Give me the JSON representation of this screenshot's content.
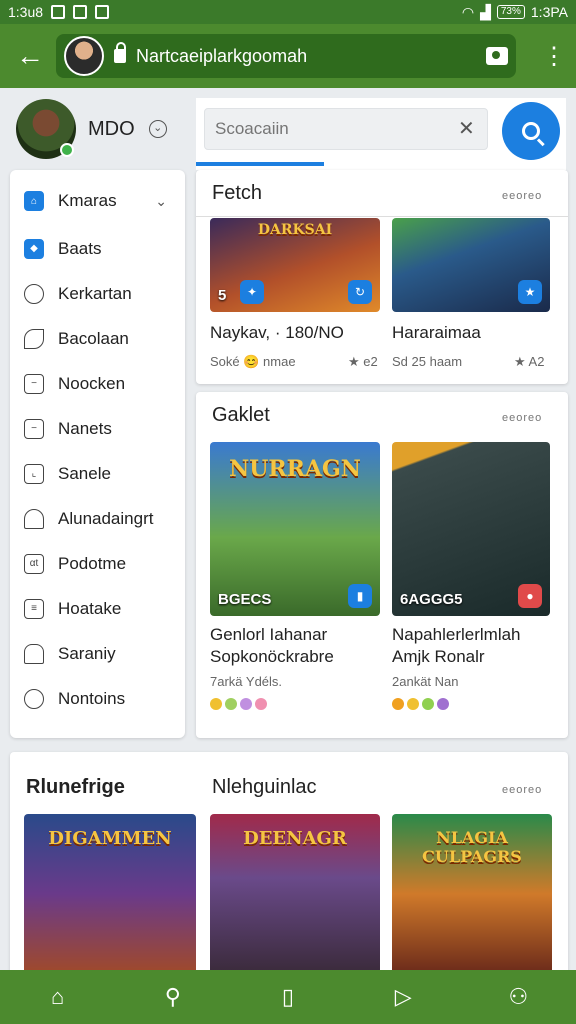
{
  "status_bar": {
    "time_left": "1:3u8",
    "time_right": "1:3PA",
    "battery": "73%"
  },
  "browser": {
    "url": "Nartcaeiplarkgoomah"
  },
  "profile": {
    "name": "MDO"
  },
  "sidebar": {
    "items": [
      {
        "label": "Kmaras",
        "icon": "home-icon",
        "active": true,
        "has_chevron": true
      },
      {
        "label": "Baats",
        "icon": "diamond-icon",
        "active": true
      },
      {
        "label": "Kerkartan",
        "icon": "chat-icon"
      },
      {
        "label": "Bacolaan",
        "icon": "leaf-icon"
      },
      {
        "label": "Noocken",
        "icon": "square-icon"
      },
      {
        "label": "Nanets",
        "icon": "square-icon"
      },
      {
        "label": "Sanele",
        "icon": "square-icon"
      },
      {
        "label": "Alunadaingrt",
        "icon": "user-icon"
      },
      {
        "label": "Podotme",
        "icon": "grid-icon"
      },
      {
        "label": "Hoatake",
        "icon": "book-icon"
      },
      {
        "label": "Saraniy",
        "icon": "home-outline-icon"
      },
      {
        "label": "Nontoins",
        "icon": "person-icon"
      }
    ]
  },
  "search": {
    "placeholder": "Scoacaiin"
  },
  "sections": {
    "fetch": {
      "title": "Fetch",
      "see_more": "eeoreo",
      "games": [
        {
          "title": "Naykav, · 180/NO",
          "meta": "Soké 😊 nmae",
          "rating": "★ e2",
          "badge": "5",
          "art_title": "DARKSAI"
        },
        {
          "title": "Hararaimaa",
          "meta": "Sd 25 haam",
          "rating": "★ A2",
          "badge": "",
          "art_title": ""
        }
      ]
    },
    "gaklet": {
      "title": "Gaklet",
      "see_more": "eeoreo",
      "games": [
        {
          "title": "Genlorl Iahanar\nSopkonöckrabre",
          "meta": "7arkä Ydéls.",
          "badge": "BGECS",
          "art_title": "NURRAGN"
        },
        {
          "title": "Napahlerlerlmlah\nAmjk Ronalr",
          "meta": "2ankät Nan",
          "badge": "6AGGG5",
          "art_title": ""
        }
      ]
    },
    "bottom": {
      "left_title": "Rlunefrige",
      "mid_title": "Nlehguinlac",
      "see_more": "eeoreo",
      "art_titles": [
        "DIGAMMEN",
        "DEENAGR",
        "NLAGIA CULPAGRS"
      ]
    }
  },
  "colors": {
    "brand_green": "#4c8a2e",
    "accent_blue": "#1c7fe0"
  }
}
